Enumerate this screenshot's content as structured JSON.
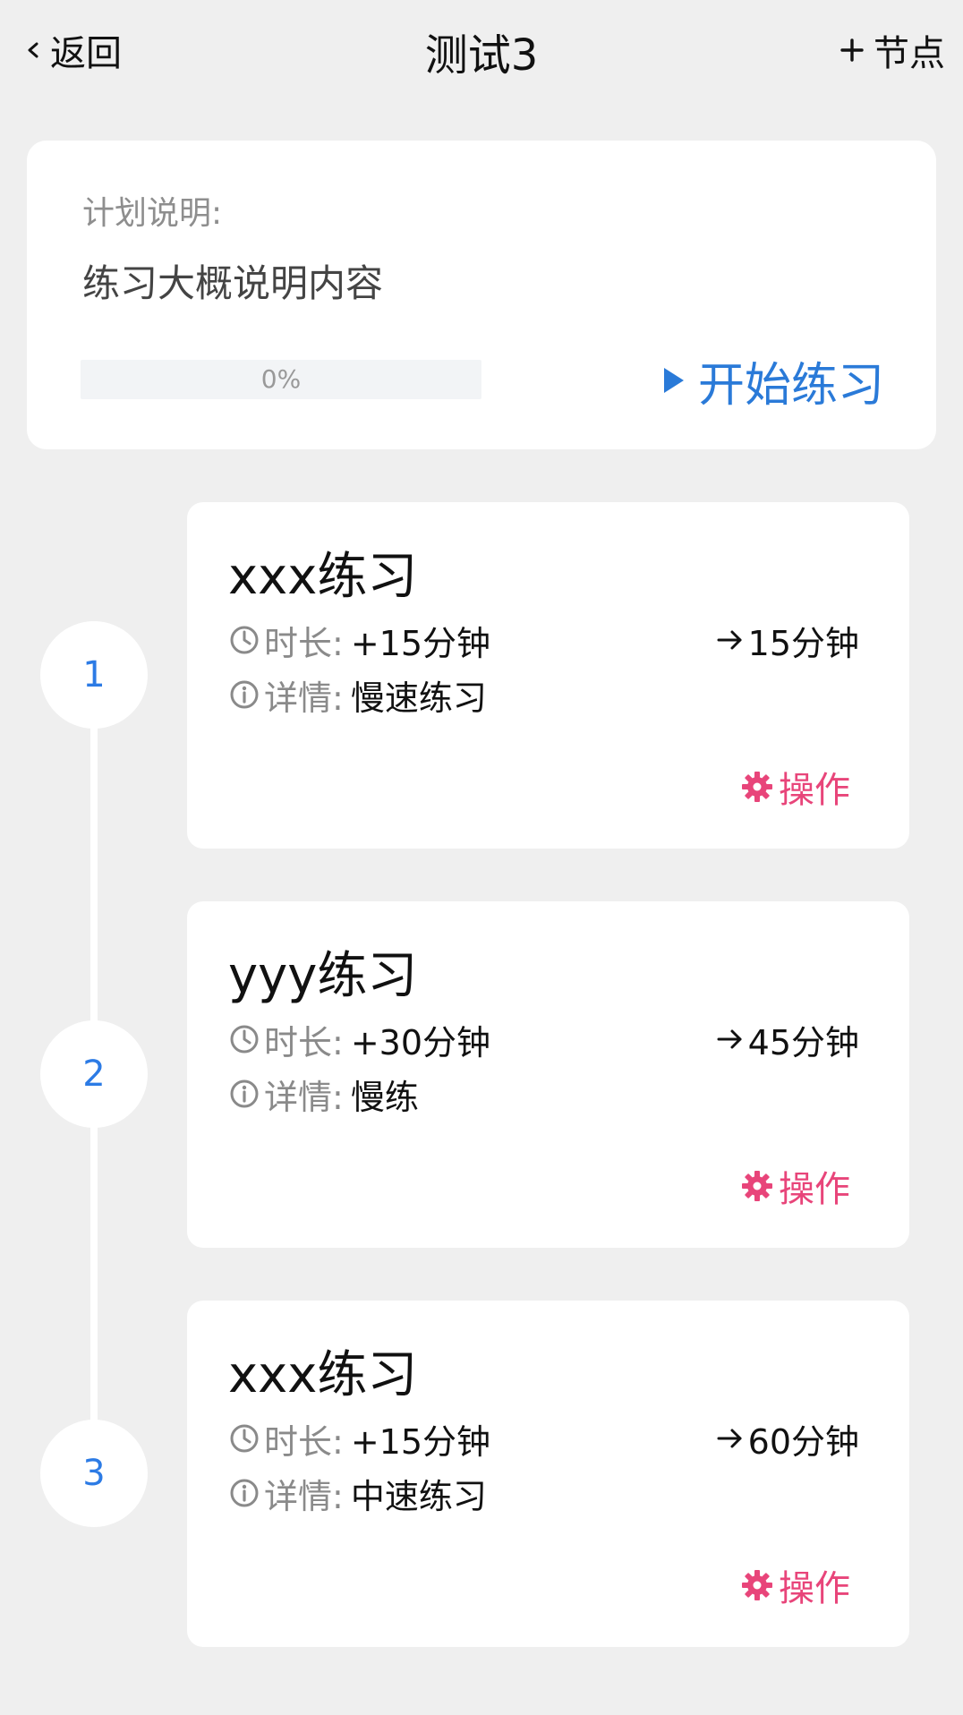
{
  "nav": {
    "back_label": "返回",
    "title": "测试3",
    "add_label": "节点"
  },
  "plan": {
    "label": "计划说明:",
    "description": "练习大概说明内容",
    "progress_text": "0%",
    "progress_fraction": 0,
    "start_label": "开始练习"
  },
  "colors": {
    "accent_blue": "#2a7ad8",
    "operation_pink": "#e8457a",
    "background": "#efefef"
  },
  "nodes": [
    {
      "index": "1",
      "title": "xxx练习",
      "duration_key": "时长:",
      "duration_value": "+15分钟",
      "total": "15分钟",
      "detail_key": "详情:",
      "detail_value": "慢速练习",
      "operation_label": "操作"
    },
    {
      "index": "2",
      "title": "yyy练习",
      "duration_key": "时长:",
      "duration_value": "+30分钟",
      "total": "45分钟",
      "detail_key": "详情:",
      "detail_value": "慢练",
      "operation_label": "操作"
    },
    {
      "index": "3",
      "title": "xxx练习",
      "duration_key": "时长:",
      "duration_value": "+15分钟",
      "total": "60分钟",
      "detail_key": "详情:",
      "detail_value": "中速练习",
      "operation_label": "操作"
    }
  ],
  "icons": {
    "back": "chevron-left-icon",
    "add": "plus-icon",
    "start": "play-icon",
    "duration": "clock-icon",
    "detail": "info-icon",
    "total": "arrow-right-icon",
    "operation": "gear-icon"
  }
}
